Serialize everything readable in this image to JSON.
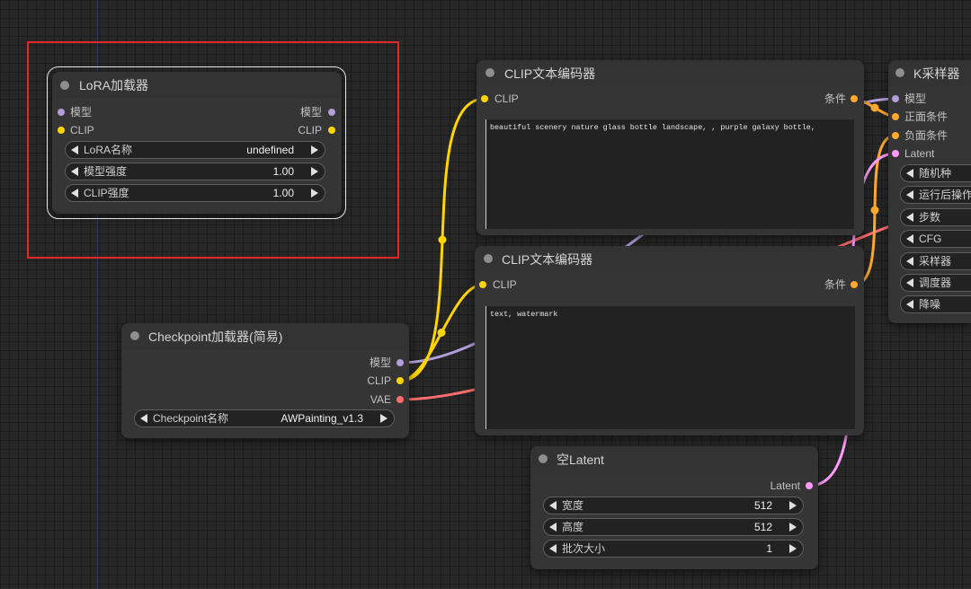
{
  "canvas": {
    "background": "#272727",
    "axis_color": "#2c3c60"
  },
  "highlight": {
    "color": "#e02a2a"
  },
  "colors": {
    "model": "#b39ddb",
    "clip": "#ffd500",
    "vae": "#ff6e6e",
    "conditioning": "#ffa931",
    "latent": "#ff9cf9"
  },
  "icons": {
    "title_status": "status-dot-icon",
    "widget_decrement": "arrow-left-icon",
    "widget_increment": "arrow-right-icon"
  },
  "nodes": {
    "lora_loader": {
      "title": "LoRA加载器",
      "inputs": [
        {
          "label": "模型"
        },
        {
          "label": "CLIP"
        }
      ],
      "outputs": [
        {
          "label": "模型"
        },
        {
          "label": "CLIP"
        }
      ],
      "widgets": [
        {
          "label": "LoRA名称",
          "value": "undefined"
        },
        {
          "label": "模型强度",
          "value": "1.00"
        },
        {
          "label": "CLIP强度",
          "value": "1.00"
        }
      ]
    },
    "clip_text_encoder_1": {
      "title": "CLIP文本编码器",
      "inputs": [
        {
          "label": "CLIP"
        }
      ],
      "outputs": [
        {
          "label": "条件"
        }
      ],
      "text": "beautiful scenery nature glass bottle landscape, , purple galaxy bottle,"
    },
    "clip_text_encoder_2": {
      "title": "CLIP文本编码器",
      "inputs": [
        {
          "label": "CLIP"
        }
      ],
      "outputs": [
        {
          "label": "条件"
        }
      ],
      "text": "text, watermark"
    },
    "ksampler": {
      "title": "K采样器",
      "inputs": [
        {
          "label": "模型"
        },
        {
          "label": "正面条件"
        },
        {
          "label": "负面条件"
        },
        {
          "label": "Latent"
        }
      ],
      "widgets": [
        {
          "label": "随机种"
        },
        {
          "label": "运行后操作"
        },
        {
          "label": "步数"
        },
        {
          "label": "CFG"
        },
        {
          "label": "采样器"
        },
        {
          "label": "调度器"
        },
        {
          "label": "降噪"
        }
      ]
    },
    "checkpoint_loader": {
      "title": "Checkpoint加载器(简易)",
      "outputs": [
        {
          "label": "模型"
        },
        {
          "label": "CLIP"
        },
        {
          "label": "VAE"
        }
      ],
      "widgets": [
        {
          "label": "Checkpoint名称",
          "value": "AWPainting_v1.3"
        }
      ]
    },
    "empty_latent": {
      "title": "空Latent",
      "outputs": [
        {
          "label": "Latent"
        }
      ],
      "widgets": [
        {
          "label": "宽度",
          "value": "512"
        },
        {
          "label": "高度",
          "value": "512"
        },
        {
          "label": "批次大小",
          "value": "1"
        }
      ]
    }
  }
}
